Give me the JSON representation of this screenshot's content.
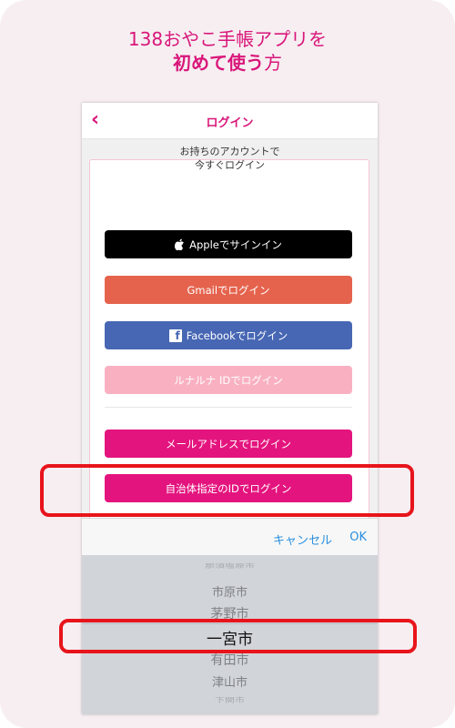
{
  "headline": {
    "line1": "138おやこ手帳アプリを",
    "line2_bold": "初めて使う",
    "line2_rest": "方"
  },
  "navbar": {
    "back": "‹",
    "title": "ログイン"
  },
  "login": {
    "prompt_line1": "お持ちのアカウントで",
    "prompt_line2": "今すぐログイン",
    "apple": "Appleでサインイン",
    "gmail": "Gmailでログイン",
    "facebook": "Facebookでログイン",
    "lunaluna": "ルナルナ IDでログイン",
    "email": "メールアドレスでログイン",
    "municipality": "自治体指定のIDでログイン"
  },
  "toolbar": {
    "cancel": "キャンセル",
    "ok": "OK"
  },
  "picker": {
    "options": [
      "那須塩原市",
      "市原市",
      "茅野市",
      "一宮市",
      "有田市",
      "津山市",
      "下関市"
    ],
    "selected": "一宮市"
  },
  "colors": {
    "brand_pink": "#e4147e",
    "apple": "#000000",
    "gmail": "#e5634d",
    "facebook": "#4767b4",
    "lunaluna": "#f9b1c2",
    "highlight": "#e8141b",
    "link_blue": "#2a8fdf"
  }
}
